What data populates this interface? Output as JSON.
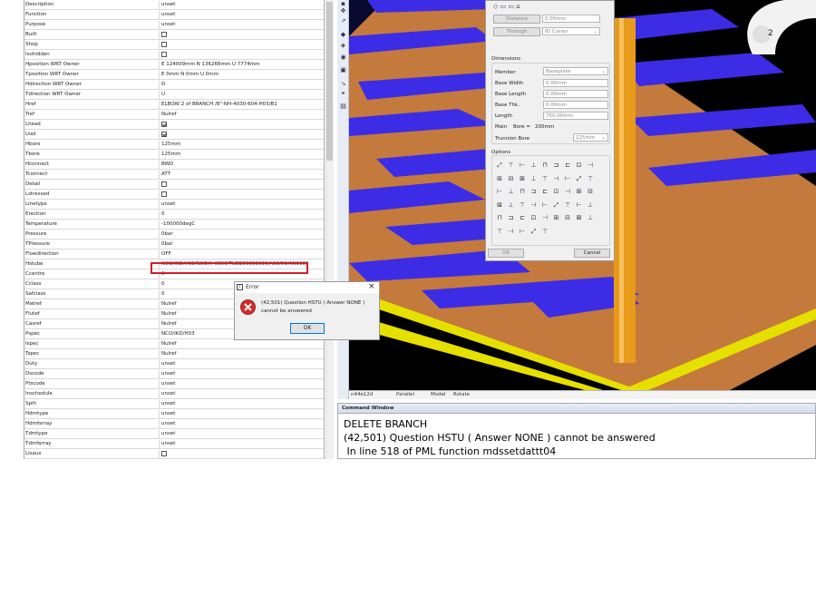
{
  "attributes": {
    "rows": [
      {
        "name": "Description",
        "value": "unset",
        "type": "text"
      },
      {
        "name": "Function",
        "value": "unset",
        "type": "text"
      },
      {
        "name": "Purpose",
        "value": "unset",
        "type": "text"
      },
      {
        "name": "Built",
        "value": "",
        "type": "check",
        "checked": false
      },
      {
        "name": "Shop",
        "value": "",
        "type": "check",
        "checked": false
      },
      {
        "name": "Isohidden",
        "value": "",
        "type": "check",
        "checked": false
      },
      {
        "name": "Hposition WRT Owner",
        "value": "E 124009mm N 136266mm U 7774mm",
        "type": "text"
      },
      {
        "name": "Tposition WRT Owner",
        "value": "E 0mm N 0mm U 0mm",
        "type": "text"
      },
      {
        "name": "Hdirection WRT Owner",
        "value": "D",
        "type": "text"
      },
      {
        "name": "Tdirection WRT Owner",
        "value": "U",
        "type": "text"
      },
      {
        "name": "Href",
        "value": "ELBOW 2 of BRANCH /8\"-NH-4030-604-H03/B1",
        "type": "text"
      },
      {
        "name": "Tref",
        "value": "Nulref",
        "type": "text"
      },
      {
        "name": "Lhead",
        "value": "",
        "type": "check",
        "checked": true
      },
      {
        "name": "Ltail",
        "value": "",
        "type": "check",
        "checked": true
      },
      {
        "name": "Hbore",
        "value": "125mm",
        "type": "text"
      },
      {
        "name": "Tbore",
        "value": "125mm",
        "type": "text"
      },
      {
        "name": "Hconnect",
        "value": "BWD",
        "type": "text"
      },
      {
        "name": "Tconnect",
        "value": "ATT",
        "type": "text"
      },
      {
        "name": "Detail",
        "value": "",
        "type": "check",
        "checked": false
      },
      {
        "name": "Lstressed",
        "value": "",
        "type": "check",
        "checked": false
      },
      {
        "name": "Linetype",
        "value": "unset",
        "type": "text"
      },
      {
        "name": "Erection",
        "value": "0",
        "type": "text"
      },
      {
        "name": "Temperature",
        "value": "-100000degC",
        "type": "text"
      },
      {
        "name": "Pressure",
        "value": "0bar",
        "type": "text"
      },
      {
        "name": "TPressure",
        "value": "0bar",
        "type": "text"
      },
      {
        "name": "Flowdirection",
        "value": "OFF",
        "type": "text"
      },
      {
        "name": "Hstube",
        "value": "NCO/IKD/H03/NCO/H-0000/TUBE00000000/A00/00/AN0000",
        "type": "text",
        "highlight": true
      },
      {
        "name": "Ccentre",
        "value": "0",
        "type": "text"
      },
      {
        "name": "Cclass",
        "value": "0",
        "type": "text"
      },
      {
        "name": "Safclass",
        "value": "0",
        "type": "text"
      },
      {
        "name": "Matref",
        "value": "Nulref",
        "type": "text"
      },
      {
        "name": "Flutef",
        "value": "Nulref",
        "type": "text"
      },
      {
        "name": "Casref",
        "value": "Nulref",
        "type": "text"
      },
      {
        "name": "Pspec",
        "value": "NCO/IKD/H03",
        "type": "text"
      },
      {
        "name": "Ispec",
        "value": "Nulref",
        "type": "text"
      },
      {
        "name": "Tspec",
        "value": "Nulref",
        "type": "text"
      },
      {
        "name": "Duty",
        "value": "unset",
        "type": "text"
      },
      {
        "name": "Dscode",
        "value": "unset",
        "type": "text"
      },
      {
        "name": "Ptscode",
        "value": "unset",
        "type": "text"
      },
      {
        "name": "Inschedule",
        "value": "unset",
        "type": "text"
      },
      {
        "name": "Splh",
        "value": "unset",
        "type": "text"
      },
      {
        "name": "Hdmtype",
        "value": "unset",
        "type": "text"
      },
      {
        "name": "Hdmfarray",
        "value": "unset",
        "type": "text"
      },
      {
        "name": "Tdmtype",
        "value": "unset",
        "type": "text"
      },
      {
        "name": "Tdmfarray",
        "value": "unset",
        "type": "text"
      },
      {
        "name": "Lisaux",
        "value": "",
        "type": "check",
        "checked": false
      }
    ]
  },
  "viewport": {
    "label_marker": "2",
    "status": {
      "coord": "n44e12d",
      "mode": "Parallel",
      "view": "Model",
      "action": "Rotate"
    }
  },
  "dialog": {
    "distance_label": "Distance",
    "distance_value": "0.00mm",
    "through_label": "Through",
    "through_value": "ID Cursor",
    "dimensions_heading": "Dimensions",
    "member_label": "Member",
    "member_value": "Baseplate",
    "base_width_label": "Base Width",
    "base_width_value": "0.00mm",
    "base_length_label": "Base Length",
    "base_length_value": "0.00mm",
    "base_thk_label": "Base Thk.",
    "base_thk_value": "0.00mm",
    "length_label": "Length",
    "length_value": "750.00mm",
    "main_label": "Main",
    "bore_label": "Bore =",
    "bore_value": "200mm",
    "trunnion_bore_label": "Trunnion Bore",
    "trunnion_bore_value": "125mm",
    "options_heading": "Options",
    "ok_label": "OK",
    "cancel_label": "Cancel"
  },
  "error": {
    "title": "Error",
    "message_line1": "(42,501)  Question HSTU ( Answer NONE )",
    "message_line2": "cannot be answered",
    "ok_label": "OK"
  },
  "command_window": {
    "title": "Command Window",
    "lines": [
      "DELETE BRANCH",
      "(42,501)  Question HSTU ( Answer NONE ) cannot be answered",
      " In line 518 of PML function mdssetdattt04"
    ]
  },
  "colors": {
    "viewport_bg": "#000000",
    "floor": "#c87a3a",
    "steel": "#3a2ae8",
    "structure": "#e8e000",
    "pipe": "#f0a020",
    "error_highlight": "#d0202a"
  }
}
